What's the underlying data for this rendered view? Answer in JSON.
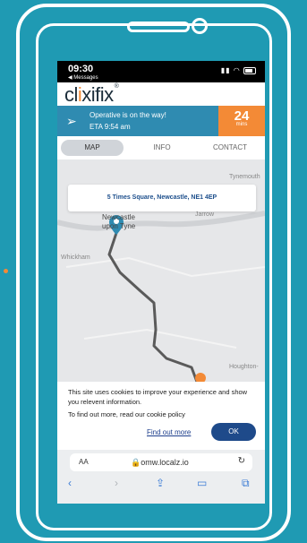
{
  "status": {
    "time": "09:30",
    "back_label": "◀ Messages"
  },
  "brand": {
    "logo_part1": "cl",
    "logo_i": "i",
    "logo_part2": "xifix",
    "reg": "®"
  },
  "eta": {
    "message": "Operative is on the way!",
    "time": "ETA 9:54 am",
    "minutes": "24",
    "minutes_label": "mins"
  },
  "tabs": [
    {
      "label": "MAP"
    },
    {
      "label": "INFO"
    },
    {
      "label": "CONTACT"
    }
  ],
  "map": {
    "address": "5 Times Square, Newcastle, NE1 4EP",
    "city_line1": "Newcastle",
    "city_line2": "upon Tyne",
    "labels": {
      "tynemouth": "Tynemouth",
      "jarrow": "Jarrow",
      "whickham": "Whickham",
      "houghton": "Houghton-"
    }
  },
  "cookie": {
    "text": "This site uses cookies to improve your experience and show you relevent information.",
    "policy": "To find out more, read our cookie policy",
    "find_out_more": "Find out more",
    "ok": "OK"
  },
  "browser": {
    "aa": "AA",
    "url": "omw.localz.io"
  },
  "colors": {
    "accent_orange": "#f38a36",
    "accent_blue": "#2f8bb1",
    "background": "#1f9ab3",
    "ok_button": "#1e4a8a"
  }
}
